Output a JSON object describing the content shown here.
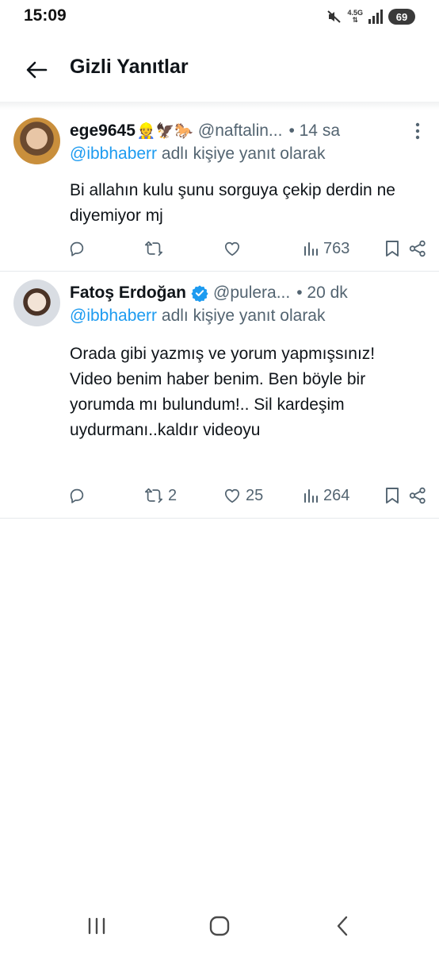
{
  "status_bar": {
    "time": "15:09",
    "network": "4.5G",
    "battery": "69"
  },
  "header": {
    "title": "Gizli Yanıtlar"
  },
  "tweets": [
    {
      "display_name": "ege9645",
      "emojis": "👷🦅🐎",
      "verified": false,
      "handle": "@naftalin...",
      "time": "• 14 sa",
      "reply_to": "@ibbhaberr",
      "reply_suffix": "adlı kişiye yanıt olarak",
      "text": "Bi allahın kulu şunu sorguya çekip derdin ne diyemiyor mj",
      "replies": "",
      "retweets": "",
      "likes": "",
      "views": "763"
    },
    {
      "display_name": "Fatoş Erdoğan",
      "emojis": "",
      "verified": true,
      "handle": "@pulera...",
      "time": "• 20 dk",
      "reply_to": "@ibbhaberr",
      "reply_suffix": "adlı kişiye yanıt olarak",
      "text": "Orada gibi yazmış ve yorum yapmışsınız! Video benim haber benim. Ben böyle bir yorumda mı bulundum!.. Sil kardeşim uydurmanı..kaldır videoyu",
      "replies": "",
      "retweets": "2",
      "likes": "25",
      "views": "264"
    }
  ],
  "colors": {
    "accent": "#1d9bf0",
    "text": "#0f1419",
    "muted": "#536471",
    "divider": "#e6e9ec"
  },
  "icons": [
    "back-arrow-icon",
    "more-icon",
    "reply-icon",
    "retweet-icon",
    "like-icon",
    "views-icon",
    "bookmark-icon",
    "share-icon",
    "verified-icon",
    "recents-icon",
    "home-icon",
    "nav-back-icon"
  ]
}
